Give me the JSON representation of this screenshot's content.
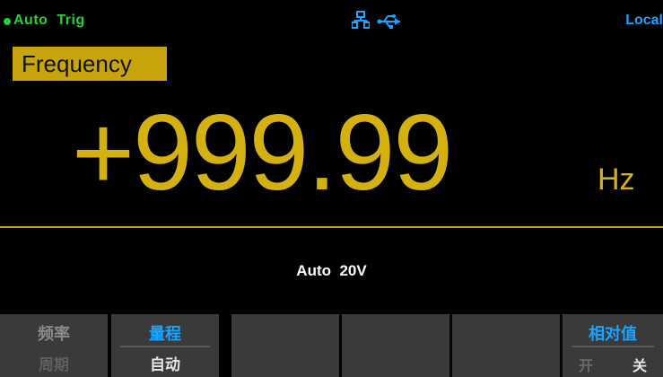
{
  "status": {
    "trigger": "Auto  Trig",
    "mode": "Local",
    "icons": [
      "lan-icon",
      "usb-icon"
    ],
    "colors": {
      "trigger": "#22d13a",
      "mode": "#1aa3ff"
    }
  },
  "measurement": {
    "function": "Frequency",
    "value": "+999.99",
    "unit": "Hz",
    "range": "Auto  20V",
    "colors": {
      "reading": "#d4b10e",
      "label_bg": "#c8a40c"
    }
  },
  "softkeys": [
    {
      "top": "频率",
      "bottom": "周期"
    },
    {
      "top": "量程",
      "bottom": "自动"
    },
    {
      "top": "",
      "bottom": ""
    },
    {
      "top": "",
      "bottom": ""
    },
    {
      "top": "",
      "bottom": ""
    },
    {
      "top": "相对值",
      "option_on": "开",
      "option_off": "关"
    }
  ]
}
